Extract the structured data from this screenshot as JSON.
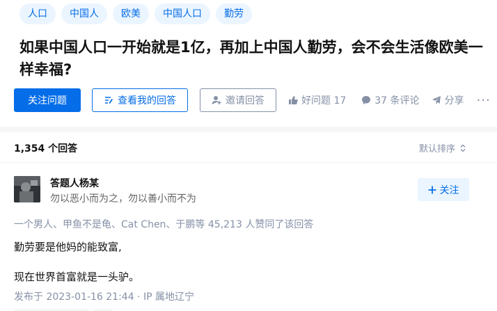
{
  "topics": [
    "人口",
    "中国人",
    "欧美",
    "中国人口",
    "勤劳"
  ],
  "question": {
    "title": "如果中国人口一开始就是1亿，再加上中国人勤劳，会不会生活像欧美一样幸福?"
  },
  "actions": {
    "follow_question": "关注问题",
    "view_my_answer": "查看我的回答",
    "invite_answer": "邀请回答",
    "good_question": "好问题 17",
    "comments": "37 条评论",
    "share": "分享",
    "more": "···"
  },
  "answers_header": {
    "count": "1,354 个回答",
    "sort": "默认排序"
  },
  "answer": {
    "author_name": "答题人杨某",
    "author_bio": "勿以恶小而为之，勿以善小而不为",
    "follow_label": "关注",
    "voters": "一个男人、甲鱼不是龟、Cat Chen、于鹏等 45,213 人赞同了该回答",
    "content": [
      "勤劳要是他妈的能致富,",
      "现在世界首富就是一头驴。"
    ],
    "posted": "发布于 2023-01-16 21:44 · IP 属地辽宁"
  },
  "colors": {
    "brand": "#056de8",
    "brand_light": "#ebf5ff",
    "muted": "#8590a6"
  },
  "icons": [
    "pencil-icon",
    "invite-user-icon",
    "thumbs-up-icon",
    "comment-icon",
    "share-icon",
    "more-icon",
    "sort-chevron-icon",
    "plus-icon"
  ]
}
